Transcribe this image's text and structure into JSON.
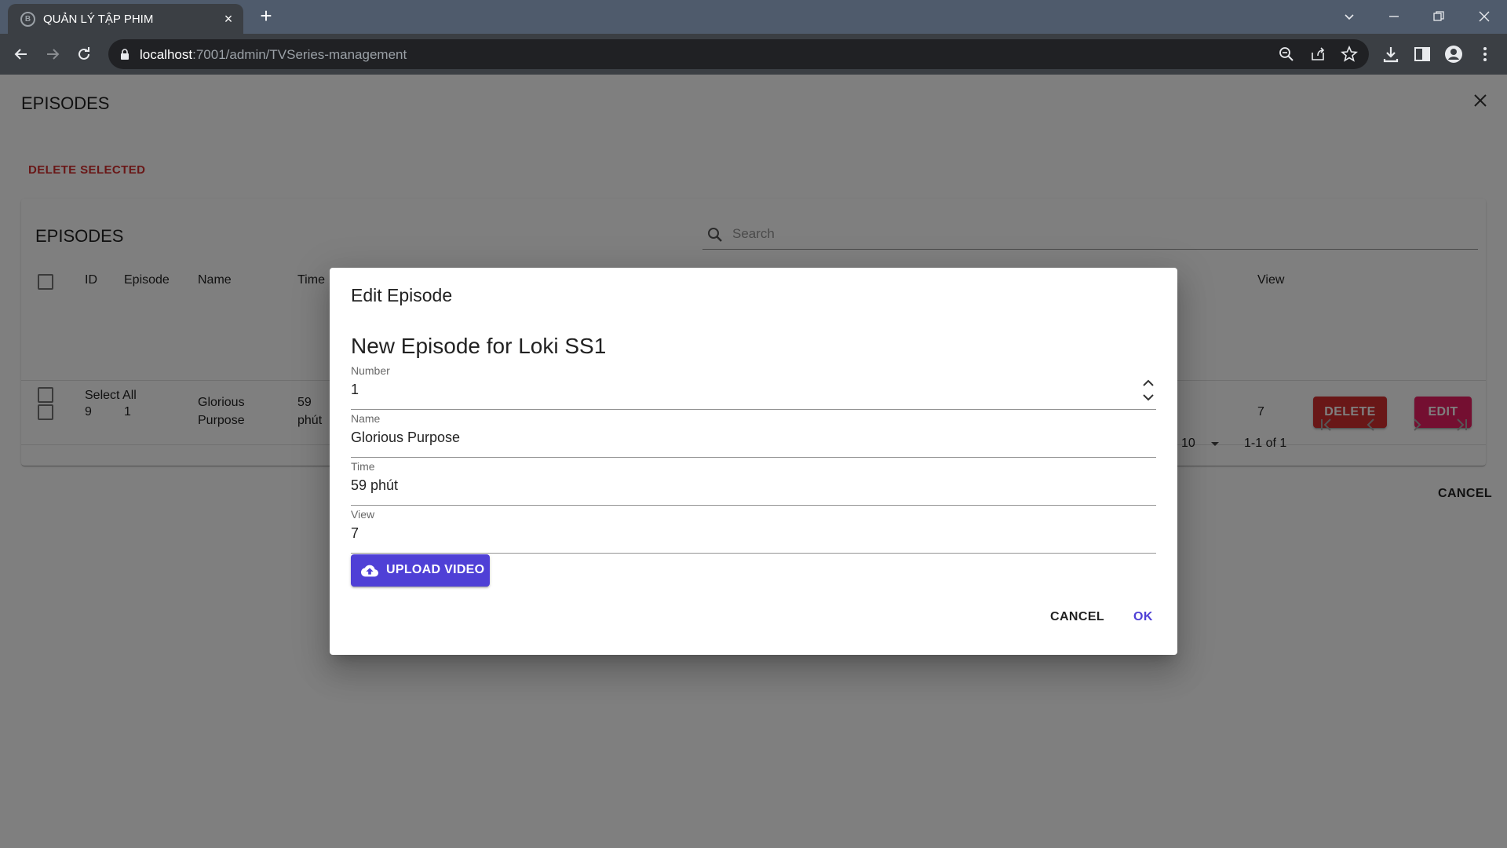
{
  "browser": {
    "tab_title": "QUẢN LÝ TẬP PHIM",
    "url_host": "localhost",
    "url_path": ":7001/admin/TVSeries-management",
    "icons": [
      "favicon-icon",
      "close-icon",
      "plus-icon",
      "chevron-down-icon",
      "minimize-icon",
      "restore-icon",
      "close-window-icon",
      "back-icon",
      "forward-icon",
      "reload-icon",
      "lock-icon",
      "zoom-icon",
      "share-icon",
      "star-icon",
      "download-icon",
      "sidepanel-icon",
      "profile-icon",
      "menu-icon"
    ]
  },
  "page": {
    "title": "EPISODES",
    "delete_selected_label": "DELETE SELECTED",
    "cancel_label": "CANCEL",
    "table": {
      "title": "EPISODES",
      "search_placeholder": "Search",
      "columns": {
        "id": "ID",
        "episode": "Episode",
        "name": "Name",
        "time": "Time",
        "view": "View"
      },
      "rows": [
        {
          "id": "9",
          "episode": "1",
          "name_line1": "Glorious",
          "name_line2": "Purpose",
          "time_line1": "59",
          "time_line2": "phút",
          "view": "7",
          "delete_label": "DELETE",
          "edit_label": "EDIT"
        }
      ],
      "select_all_label": "Select All",
      "pagination": {
        "rows_per_page": "10",
        "range": "1-1 of 1"
      }
    }
  },
  "dialog": {
    "title": "Edit Episode",
    "subtitle": "New Episode for Loki SS1",
    "fields": {
      "number": {
        "label": "Number",
        "value": "1"
      },
      "name": {
        "label": "Name",
        "value": "Glorious Purpose"
      },
      "time": {
        "label": "Time",
        "value": "59 phút"
      },
      "view": {
        "label": "View",
        "value": "7"
      }
    },
    "upload_label": "UPLOAD VIDEO",
    "cancel_label": "CANCEL",
    "ok_label": "OK"
  },
  "colors": {
    "delete_red": "#d32f2f",
    "edit_pink": "#e91e63",
    "primary_purple": "#4f40d6"
  }
}
